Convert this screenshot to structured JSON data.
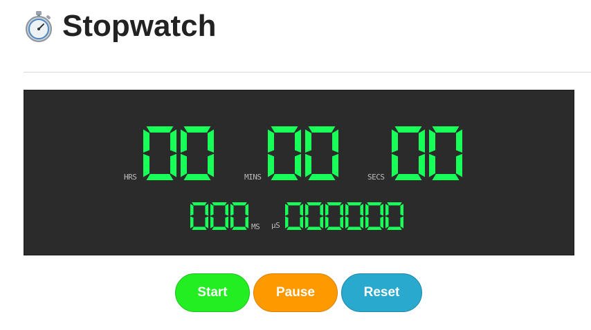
{
  "header": {
    "title": "Stopwatch",
    "icon": "stopwatch-icon"
  },
  "display": {
    "digit_color": "#19ff5a",
    "background_color": "#2b2b2b",
    "hours": "00",
    "minutes": "00",
    "seconds": "00",
    "milliseconds": "000",
    "microseconds": "000000",
    "labels": {
      "hours": "HRS",
      "minutes": "MINS",
      "seconds": "SECS",
      "milliseconds": "MS",
      "microseconds": "µS"
    }
  },
  "controls": {
    "start": {
      "label": "Start",
      "color": "#22ee22"
    },
    "pause": {
      "label": "Pause",
      "color": "#ff9900"
    },
    "reset": {
      "label": "Reset",
      "color": "#2aa9cf"
    }
  }
}
